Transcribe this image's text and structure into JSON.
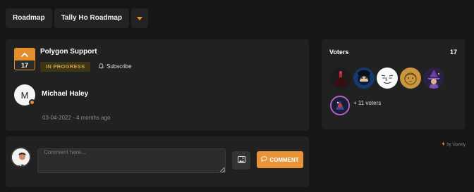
{
  "breadcrumb": {
    "items": [
      "Roadmap",
      "Tally Ho Roadmap"
    ]
  },
  "post": {
    "vote_count": "17",
    "title": "Polygon Support",
    "status": "IN PROGRESS",
    "subscribe_label": "Subscribe",
    "author": {
      "initial": "M",
      "name": "Michael Haley"
    },
    "date": "03-04-2022 - 4 months ago"
  },
  "comment": {
    "placeholder": "Comment here...",
    "button_label": "COMMENT"
  },
  "voters": {
    "title": "Voters",
    "count": "17",
    "more_label": "+ 11 voters"
  },
  "footer": {
    "powered_by": "by Upvoty"
  },
  "colors": {
    "accent": "#e58f2c",
    "status_text": "#c8a24a",
    "status_bg": "#3d3516"
  }
}
